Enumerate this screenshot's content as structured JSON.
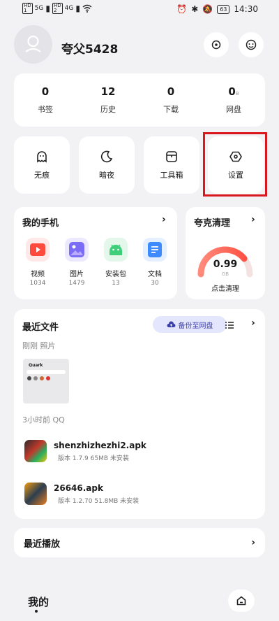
{
  "status_bar": {
    "time": "14:30",
    "battery": "63",
    "signal1": "5G",
    "signal2": "4G"
  },
  "profile": {
    "username": "夸父5428"
  },
  "stats": [
    {
      "num": "0",
      "label": "书签"
    },
    {
      "num": "12",
      "label": "历史"
    },
    {
      "num": "0",
      "label": "下载"
    },
    {
      "num": "0",
      "sub": "B",
      "label": "网盘"
    }
  ],
  "tools": [
    {
      "label": "无痕",
      "icon": "ghost-icon"
    },
    {
      "label": "暗夜",
      "icon": "moon-icon"
    },
    {
      "label": "工具箱",
      "icon": "toolbox-icon"
    },
    {
      "label": "设置",
      "icon": "settings-icon"
    }
  ],
  "my_phone": {
    "title": "我的手机",
    "apps": [
      {
        "label": "视频",
        "count": "1034",
        "color": "#ff4b3e"
      },
      {
        "label": "图片",
        "count": "1479",
        "color": "#7a6cf5"
      },
      {
        "label": "安装包",
        "count": "13",
        "color": "#3fcf7a"
      },
      {
        "label": "文档",
        "count": "30",
        "color": "#3d8bff"
      }
    ]
  },
  "cleaner": {
    "title": "夸克清理",
    "value": "0.99",
    "unit": "GB",
    "action": "点击清理",
    "gauge_fraction": 0.78
  },
  "recent_files": {
    "title": "最近文件",
    "backup_label": "备份至网盘",
    "group1": "刚刚  照片",
    "thumb_title": "Quark",
    "group2": "3小时前  QQ",
    "files": [
      {
        "name": "shenzhizhezhi2.apk",
        "meta": "版本 1.7.9   65MB   未安装"
      },
      {
        "name": "26646.apk",
        "meta": "版本 1.2.70   51.8MB   未安装"
      }
    ]
  },
  "recent_play": {
    "title": "最近播放"
  },
  "bottom": {
    "title": "我的"
  }
}
